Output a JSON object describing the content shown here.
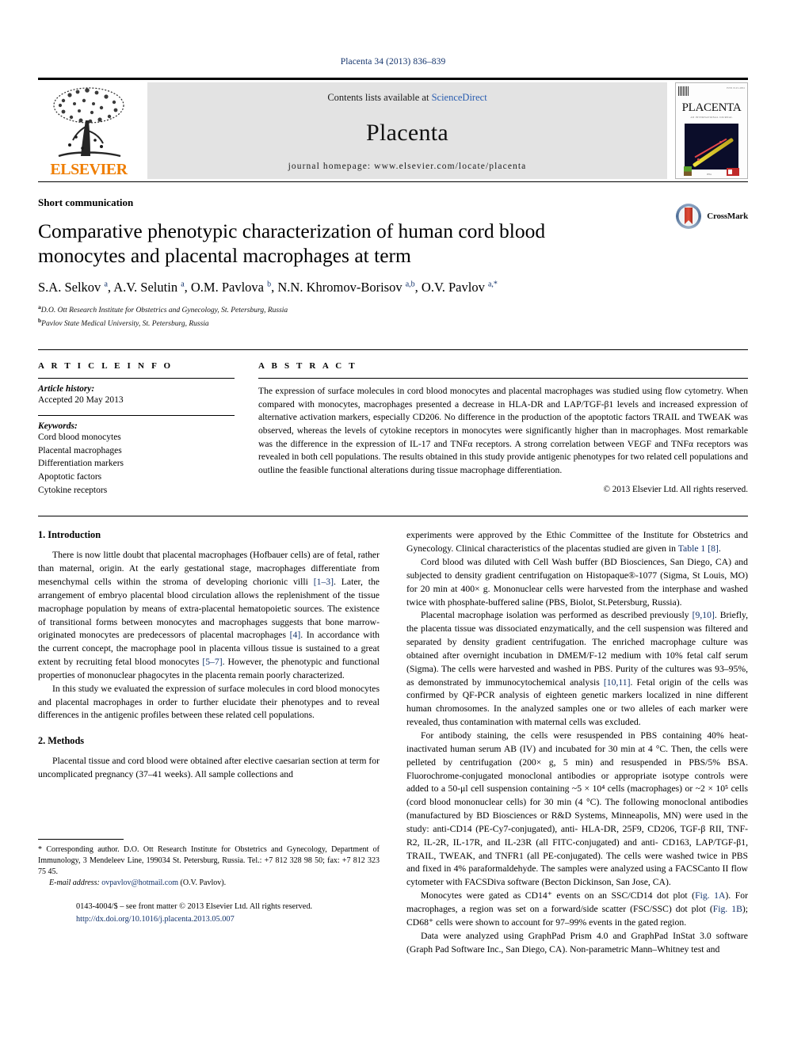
{
  "running_head": "Placenta 34 (2013) 836–839",
  "masthead": {
    "contents_prefix": "Contents lists available at ",
    "sciencedirect": "ScienceDirect",
    "journal_name": "Placenta",
    "homepage": "journal homepage: www.elsevier.com/locate/placenta",
    "publisher": "ELSEVIER",
    "cover_title": "PLACENTA",
    "cover_subtitle": "AN INTERNATIONAL JOURNAL"
  },
  "title_block": {
    "article_type": "Short communication",
    "title": "Comparative phenotypic characterization of human cord blood monocytes and placental macrophages at term",
    "crossmark_label": "CrossMark",
    "authors_html": "S.A. Selkov <sup>a</sup>, A.V. Selutin <sup>a</sup>, O.M. Pavlova <sup>b</sup>, N.N. Khromov-Borisov <sup>a,b</sup>, O.V. Pavlov <sup>a,*</sup>",
    "affiliations": [
      {
        "mark": "a",
        "text": "D.O. Ott Research Institute for Obstetrics and Gynecology, St. Petersburg, Russia"
      },
      {
        "mark": "b",
        "text": "Pavlov State Medical University, St. Petersburg, Russia"
      }
    ]
  },
  "article_info": {
    "heading": "A R T I C L E   I N F O",
    "history_label": "Article history:",
    "history_value": "Accepted 20 May 2013",
    "keywords_label": "Keywords:",
    "keywords": [
      "Cord blood monocytes",
      "Placental macrophages",
      "Differentiation markers",
      "Apoptotic factors",
      "Cytokine receptors"
    ]
  },
  "abstract": {
    "heading": "A B S T R A C T",
    "text": "The expression of surface molecules in cord blood monocytes and placental macrophages was studied using flow cytometry. When compared with monocytes, macrophages presented a decrease in HLA-DR and LAP/TGF-β1 levels and increased expression of alternative activation markers, especially CD206. No difference in the production of the apoptotic factors TRAIL and TWEAK was observed, whereas the levels of cytokine receptors in monocytes were significantly higher than in macrophages. Most remarkable was the difference in the expression of IL-17 and TNFα receptors. A strong correlation between VEGF and TNFα receptors was revealed in both cell populations. The results obtained in this study provide antigenic phenotypes for two related cell populations and outline the feasible functional alterations during tissue macrophage differentiation.",
    "copyright": "© 2013 Elsevier Ltd. All rights reserved."
  },
  "sections": {
    "intro_heading": "1. Introduction",
    "intro_p1_a": "There is now little doubt that placental macrophages (Hofbauer cells) are of fetal, rather than maternal, origin. At the early gestational stage, macrophages differentiate from mesenchymal cells within the stroma of developing chorionic villi ",
    "intro_p1_ref1": "[1–3]",
    "intro_p1_b": ". Later, the arrangement of embryo placental blood circulation allows the replenishment of the tissue macrophage population by means of extra-placental hematopoietic sources. The existence of transitional forms between monocytes and macrophages suggests that bone marrow-originated monocytes are predecessors of placental macrophages ",
    "intro_p1_ref2": "[4]",
    "intro_p1_c": ". In accordance with the current concept, the macrophage pool in placenta villous tissue is sustained to a great extent by recruiting fetal blood monocytes ",
    "intro_p1_ref3": "[5–7]",
    "intro_p1_d": ". However, the phenotypic and functional properties of mononuclear phagocytes in the placenta remain poorly characterized.",
    "intro_p2": "In this study we evaluated the expression of surface molecules in cord blood monocytes and placental macrophages in order to further elucidate their phenotypes and to reveal differences in the antigenic profiles between these related cell populations.",
    "methods_heading": "2. Methods",
    "methods_p1": "Placental tissue and cord blood were obtained after elective caesarian section at term for uncomplicated pregnancy (37–41 weeks). All sample collections and",
    "methods_p1_cont_a": "experiments were approved by the Ethic Committee of the Institute for Obstetrics and Gynecology. Clinical characteristics of the placentas studied are given in ",
    "methods_p1_cont_table": "Table 1",
    "methods_p1_cont_b": " ",
    "methods_p1_cont_ref": "[8]",
    "methods_p1_cont_c": ".",
    "methods_p2": "Cord blood was diluted with Cell Wash buffer (BD Biosciences, San Diego, CA) and subjected to density gradient centrifugation on Histopaque®-1077 (Sigma, St Louis, MO) for 20 min at 400× g. Mononuclear cells were harvested from the interphase and washed twice with phosphate-buffered saline (PBS, Biolot, St.Petersburg, Russia).",
    "methods_p3_a": "Placental macrophage isolation was performed as described previously ",
    "methods_p3_ref1": "[9,10]",
    "methods_p3_b": ". Briefly, the placenta tissue was dissociated enzymatically, and the cell suspension was filtered and separated by density gradient centrifugation. The enriched macrophage culture was obtained after overnight incubation in DMEM/F-12 medium with 10% fetal calf serum (Sigma). The cells were harvested and washed in PBS. Purity of the cultures was 93–95%, as demonstrated by immunocytochemical analysis ",
    "methods_p3_ref2": "[10,11]",
    "methods_p3_c": ". Fetal origin of the cells was confirmed by QF-PCR analysis of eighteen genetic markers localized in nine different human chromosomes. In the analyzed samples one or two alleles of each marker were revealed, thus contamination with maternal cells was excluded.",
    "methods_p4": "For antibody staining, the cells were resuspended in PBS containing 40% heat-inactivated human serum AB (IV) and incubated for 30 min at 4 °C. Then, the cells were pelleted by centrifugation (200× g, 5 min) and resuspended in PBS/5% BSA. Fluorochrome-conjugated monoclonal antibodies or appropriate isotype controls were added to a 50-μl cell suspension containing ~5 × 10⁴ cells (macrophages) or ~2 × 10⁵ cells (cord blood mononuclear cells) for 30 min (4 °C). The following monoclonal antibodies (manufactured by BD Biosciences or R&D Systems, Minneapolis, MN) were used in the study: anti-CD14 (PE-Cy7-conjugated), anti- HLA-DR, 25F9, CD206, TGF-β RII, TNF-R2, IL-2R, IL-17R, and IL-23R (all FITC-conjugated) and anti- CD163, LAP/TGF-β1, TRAIL, TWEAK, and TNFR1 (all PE-conjugated). The cells were washed twice in PBS and fixed in 4% paraformaldehyde. The samples were analyzed using a FACSCanto II flow cytometer with FACSDiva software (Becton Dickinson, San Jose, CA).",
    "methods_p5_a": "Monocytes were gated as CD14⁺ events on an SSC/CD14 dot plot (",
    "methods_p5_fig1a": "Fig. 1A",
    "methods_p5_b": "). For macrophages, a region was set on a forward/side scatter (FSC/SSC) dot plot (",
    "methods_p5_fig1b": "Fig. 1B",
    "methods_p5_c": "); CD68⁺ cells were shown to account for 97–99% events in the gated region.",
    "methods_p6": "Data were analyzed using GraphPad Prism 4.0 and GraphPad InStat 3.0 software (Graph Pad Software Inc., San Diego, CA). Non-parametric Mann–Whitney test and"
  },
  "footnote": {
    "star": "*",
    "text": " Corresponding author. D.O. Ott Research Institute for Obstetrics and Gynecology, Department of Immunology, 3 Mendeleev Line, 199034 St. Petersburg, Russia. Tel.: +7 812 328 98 50; fax: +7 812 323 75 45.",
    "email_label": "E-mail address:",
    "email": "ovpavlov@hotmail.com",
    "email_suffix": " (O.V. Pavlov)."
  },
  "page_footer": {
    "issn_line": "0143-4004/$ – see front matter © 2013 Elsevier Ltd. All rights reserved.",
    "doi": "http://dx.doi.org/10.1016/j.placenta.2013.05.007"
  },
  "colors": {
    "link": "#12326b",
    "sciencedirect": "#2a5db0",
    "elsevier_orange": "#ef7d00",
    "masthead_bg": "#e3e3e3"
  }
}
